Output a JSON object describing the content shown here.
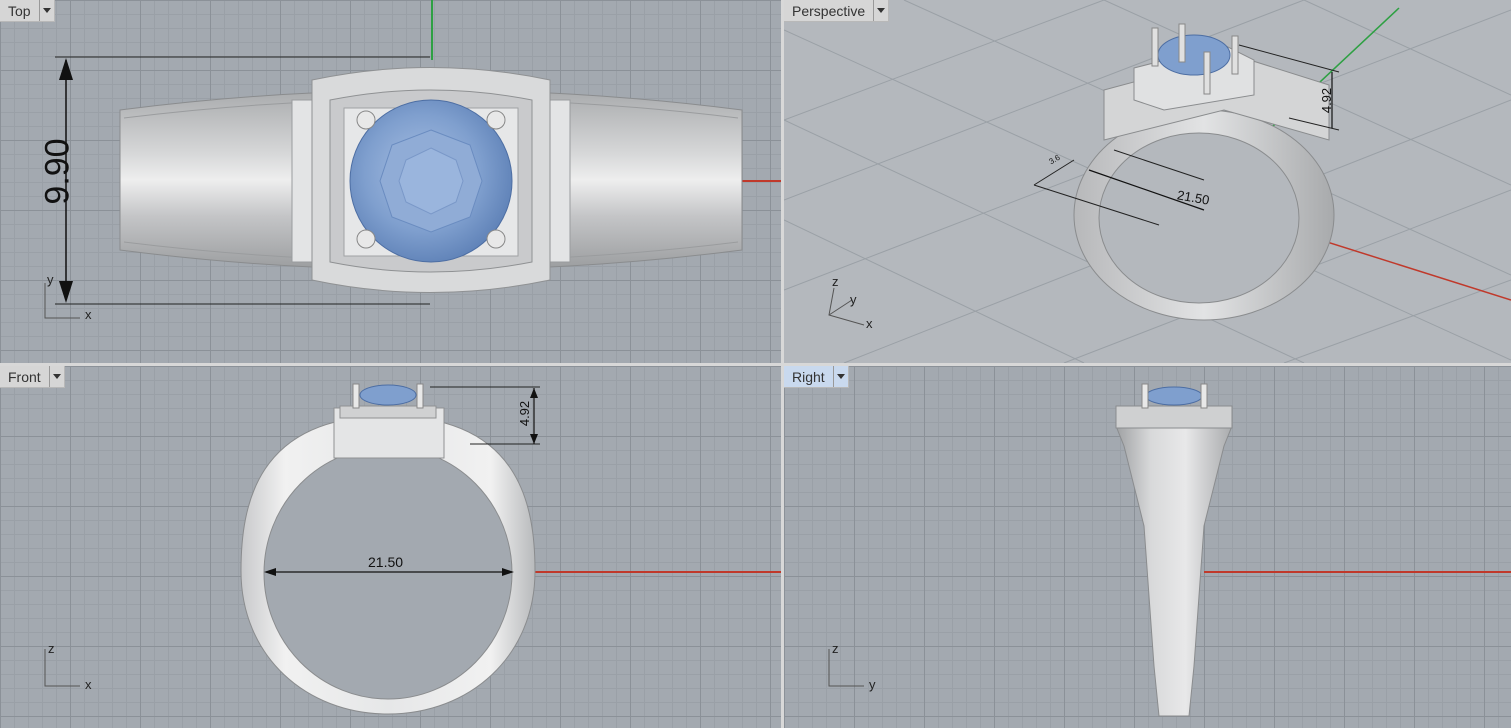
{
  "viewports": {
    "top": {
      "label": "Top"
    },
    "perspective": {
      "label": "Perspective"
    },
    "front": {
      "label": "Front"
    },
    "right": {
      "label": "Right"
    }
  },
  "axes": {
    "top": {
      "v": "y",
      "h": "x"
    },
    "perspective": {
      "z": "z",
      "y": "y",
      "x": "x"
    },
    "front": {
      "v": "z",
      "h": "x"
    },
    "right": {
      "v": "z",
      "h": "y"
    }
  },
  "dimensions": {
    "top_height": "9.90",
    "persp_height": "4.92",
    "persp_width": "21.50",
    "persp_small": "3.6",
    "front_height": "4.92",
    "front_width": "21.50"
  },
  "colors": {
    "viewport_bg": "#a3a9b0",
    "active_tab": "#c9d9ee",
    "metal": "#cfd0d2",
    "gem": "#7f9fce",
    "x_axis": "#c0392b",
    "y_axis": "#2ea043",
    "z_axis": "#3b4bd8"
  }
}
